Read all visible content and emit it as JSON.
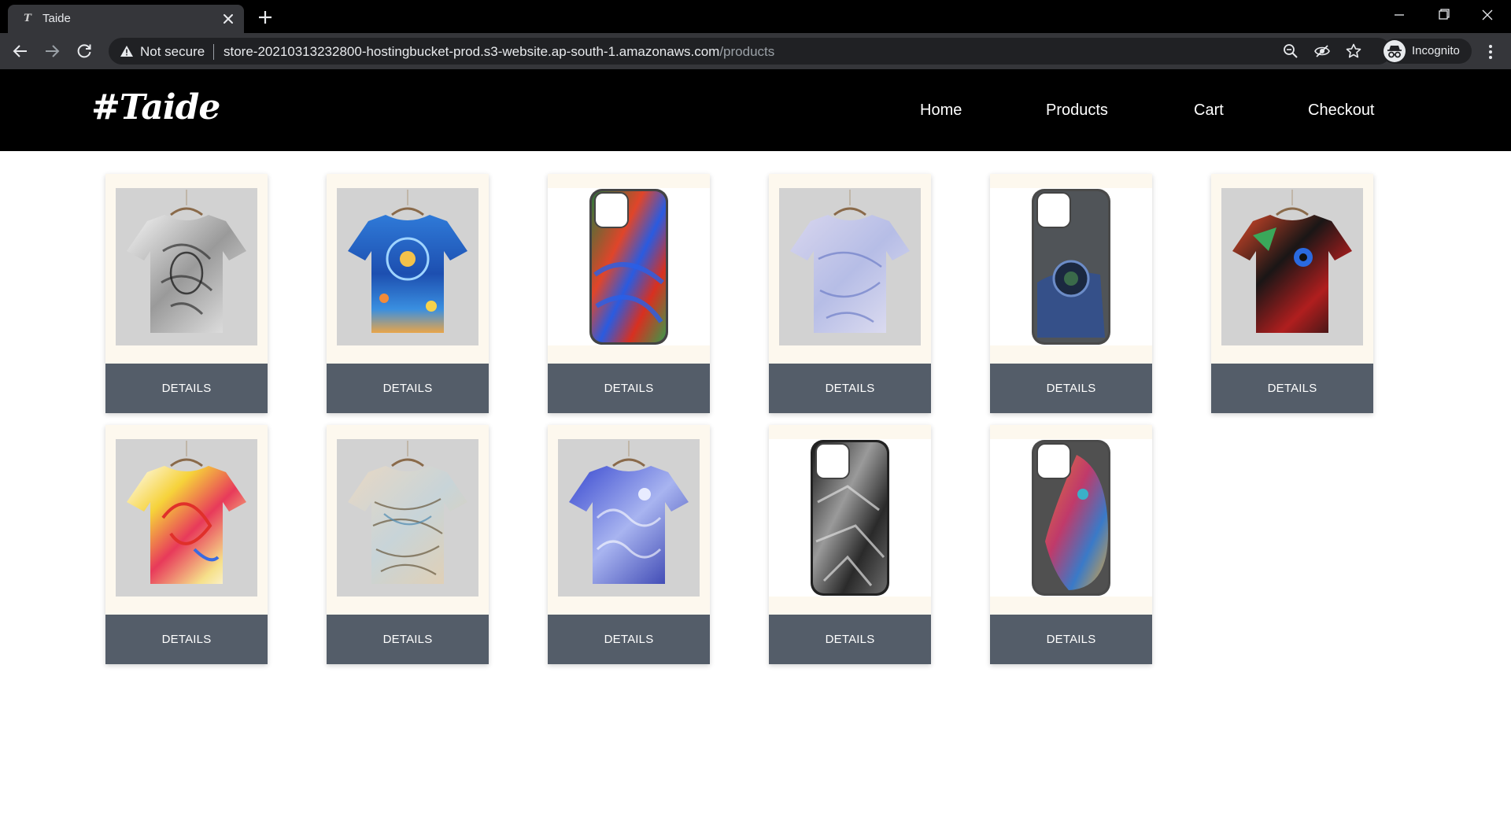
{
  "browser": {
    "tab_title": "Taide",
    "favicon_glyph": "T",
    "security_label": "Not secure",
    "url_host": "store-20210313232800-hostingbucket-prod.s3-website.ap-south-1.amazonaws.com",
    "url_path": "/products",
    "profile_label": "Incognito"
  },
  "site": {
    "logo": "#Taide",
    "nav": [
      "Home",
      "Products",
      "Cart",
      "Checkout"
    ]
  },
  "products": [
    {
      "kind": "tshirt",
      "art": "sketch-portrait",
      "button": "DETAILS"
    },
    {
      "kind": "tshirt",
      "art": "blue-cosmic",
      "button": "DETAILS"
    },
    {
      "kind": "phone",
      "art": "rainbow-swirl",
      "button": "DETAILS"
    },
    {
      "kind": "tshirt",
      "art": "pale-lilac-abstract",
      "button": "DETAILS"
    },
    {
      "kind": "phone",
      "art": "blue-lion",
      "button": "DETAILS"
    },
    {
      "kind": "tshirt",
      "art": "red-black-cat",
      "button": "DETAILS"
    },
    {
      "kind": "tshirt",
      "art": "yellow-red-swirl",
      "button": "DETAILS"
    },
    {
      "kind": "tshirt",
      "art": "earthy-lines",
      "button": "DETAILS"
    },
    {
      "kind": "tshirt",
      "art": "blue-starry",
      "button": "DETAILS"
    },
    {
      "kind": "phone",
      "art": "bw-face",
      "button": "DETAILS"
    },
    {
      "kind": "phone",
      "art": "rainbow-lion",
      "button": "DETAILS"
    }
  ],
  "colors": {
    "header_bg": "#000000",
    "button_bg": "#545d69",
    "card_bg": "#fdf8ee",
    "chrome_bg": "#35363a"
  }
}
